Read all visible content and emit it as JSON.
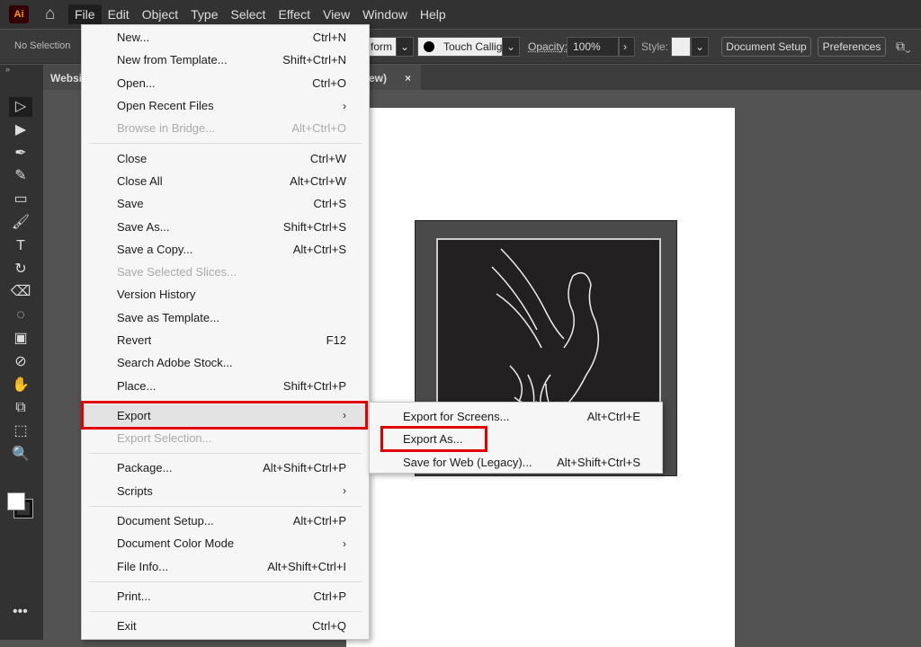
{
  "app": {
    "logo": "Ai",
    "home_icon": "home-icon"
  },
  "menubar": [
    "File",
    "Edit",
    "Object",
    "Type",
    "Select",
    "Effect",
    "View",
    "Window",
    "Help"
  ],
  "control": {
    "selection": "No Selection",
    "transform": "form",
    "brush": "Touch Callig...",
    "opacity_label": "Opacity:",
    "opacity": "100%",
    "style_label": "Style:",
    "doc_setup": "Document Setup",
    "preferences": "Preferences"
  },
  "tab": {
    "title_start": "Websi",
    "title_end": "ew)",
    "close": "×"
  },
  "file_menu": [
    {
      "label": "New...",
      "shortcut": "Ctrl+N"
    },
    {
      "label": "New from Template...",
      "shortcut": "Shift+Ctrl+N"
    },
    {
      "label": "Open...",
      "shortcut": "Ctrl+O"
    },
    {
      "label": "Open Recent Files",
      "submenu": true
    },
    {
      "label": "Browse in Bridge...",
      "shortcut": "Alt+Ctrl+O",
      "disabled": true
    },
    {
      "sep": true
    },
    {
      "label": "Close",
      "shortcut": "Ctrl+W"
    },
    {
      "label": "Close All",
      "shortcut": "Alt+Ctrl+W"
    },
    {
      "label": "Save",
      "shortcut": "Ctrl+S"
    },
    {
      "label": "Save As...",
      "shortcut": "Shift+Ctrl+S"
    },
    {
      "label": "Save a Copy...",
      "shortcut": "Alt+Ctrl+S"
    },
    {
      "label": "Save Selected Slices...",
      "disabled": true
    },
    {
      "label": "Version History"
    },
    {
      "label": "Save as Template..."
    },
    {
      "label": "Revert",
      "shortcut": "F12"
    },
    {
      "label": "Search Adobe Stock..."
    },
    {
      "label": "Place...",
      "shortcut": "Shift+Ctrl+P"
    },
    {
      "sep": true
    },
    {
      "label": "Export",
      "submenu": true,
      "highlighted": true
    },
    {
      "label": "Export Selection...",
      "disabled": true
    },
    {
      "sep": true
    },
    {
      "label": "Package...",
      "shortcut": "Alt+Shift+Ctrl+P"
    },
    {
      "label": "Scripts",
      "submenu": true
    },
    {
      "sep": true
    },
    {
      "label": "Document Setup...",
      "shortcut": "Alt+Ctrl+P"
    },
    {
      "label": "Document Color Mode",
      "submenu": true
    },
    {
      "label": "File Info...",
      "shortcut": "Alt+Shift+Ctrl+I"
    },
    {
      "sep": true
    },
    {
      "label": "Print...",
      "shortcut": "Ctrl+P"
    },
    {
      "sep": true
    },
    {
      "label": "Exit",
      "shortcut": "Ctrl+Q"
    }
  ],
  "export_submenu": [
    {
      "label": "Export for Screens...",
      "shortcut": "Alt+Ctrl+E"
    },
    {
      "label": "Export As...",
      "highlighted": true
    },
    {
      "label": "Save for Web (Legacy)...",
      "shortcut": "Alt+Shift+Ctrl+S"
    }
  ],
  "tools": [
    "selection-tool",
    "direct-selection-tool",
    "pen-tool",
    "curvature-tool",
    "rectangle-tool",
    "paintbrush-tool",
    "type-tool",
    "rotate-tool",
    "eraser-tool",
    "lasso-tool",
    "gradient-tool",
    "eyedropper-tool",
    "puppet-warp-tool",
    "shape-builder-tool",
    "artboard-tool",
    "zoom-tool"
  ],
  "colors": {
    "highlight_box": "#e00000",
    "menu_bg": "#f6f6f6",
    "app_bg": "#535353"
  }
}
